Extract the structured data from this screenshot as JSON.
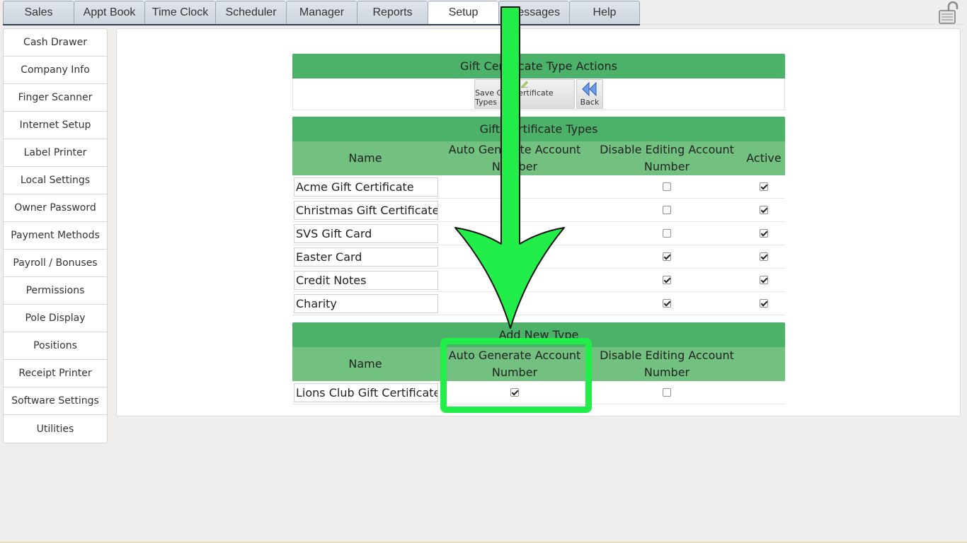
{
  "tabs": [
    {
      "label": "Sales",
      "active": false
    },
    {
      "label": "Appt Book",
      "active": false
    },
    {
      "label": "Time Clock",
      "active": false
    },
    {
      "label": "Scheduler",
      "active": false
    },
    {
      "label": "Manager",
      "active": false
    },
    {
      "label": "Reports",
      "active": false
    },
    {
      "label": "Setup",
      "active": true
    },
    {
      "label": "Messages",
      "active": false
    },
    {
      "label": "Help",
      "active": false
    }
  ],
  "sidebar": {
    "items": [
      "Cash Drawer",
      "Company Info",
      "Finger Scanner",
      "Internet Setup",
      "Label Printer",
      "Local Settings",
      "Owner Password",
      "Payment Methods",
      "Payroll / Bonuses",
      "Permissions",
      "Pole Display",
      "Positions",
      "Receipt Printer",
      "Software Settings",
      "Utilities"
    ]
  },
  "actions": {
    "title": "Gift Certificate Type Actions",
    "save_label": "Save Gift Certificate Types",
    "back_label": "Back"
  },
  "types": {
    "title": "Gift Certificate Types",
    "col_name": "Name",
    "col_auto": "Auto Generate Account Number",
    "col_disable": "Disable Editing Account Number",
    "col_active": "Active",
    "rows": [
      {
        "name": "Acme Gift Certificate",
        "disable_editing": false,
        "active": true
      },
      {
        "name": "Christmas Gift Certificate",
        "disable_editing": false,
        "active": true
      },
      {
        "name": "SVS Gift Card",
        "disable_editing": false,
        "active": true
      },
      {
        "name": "Easter Card",
        "disable_editing": true,
        "active": true
      },
      {
        "name": "Credit Notes",
        "disable_editing": true,
        "active": true
      },
      {
        "name": "Charity",
        "disable_editing": true,
        "active": true
      }
    ]
  },
  "new_type": {
    "title": "Add New Type",
    "col_name": "Name",
    "col_auto": "Auto Generate Account Number",
    "col_disable": "Disable Editing Account Number",
    "name_value": "Lions Club Gift Certificate",
    "auto_generate": true,
    "disable_editing": false
  },
  "colors": {
    "section_header": "#4cb26a",
    "column_header": "#72c180",
    "annotation": "#22ee4a",
    "tab_underline": "#2e3e55"
  }
}
